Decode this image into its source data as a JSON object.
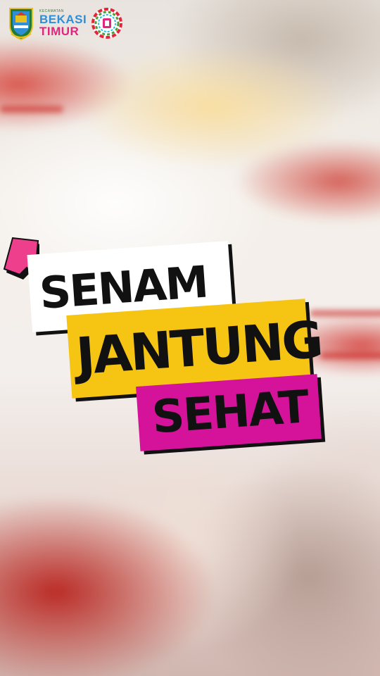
{
  "header": {
    "brand_small": "KECAMATAN",
    "brand_line1": "BEKASI",
    "brand_line2": "TIMUR",
    "crest_icon": "city-crest-icon",
    "badge_icon": "colorful-round-badge-icon"
  },
  "title": {
    "line1": "SENAM",
    "line2": "JANTUNG",
    "line3": "SEHAT"
  },
  "colors": {
    "line1_bg": "#ffffff",
    "line2_bg": "#f6c412",
    "line3_bg": "#d4139a",
    "flag": "#ee3f8c",
    "text": "#111111"
  }
}
